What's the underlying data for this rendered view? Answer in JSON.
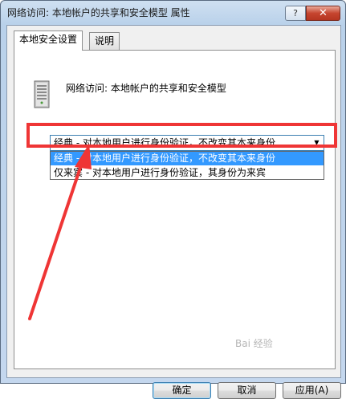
{
  "window": {
    "title": "网络访问: 本地帐户的共享和安全模型 属性",
    "help_label": "?",
    "close_label": "✕"
  },
  "tabs": [
    {
      "label": "本地安全设置"
    },
    {
      "label": "说明"
    }
  ],
  "policy": {
    "icon": "server-icon",
    "name": "网络访问: 本地帐户的共享和安全模型"
  },
  "combo": {
    "selected": "经典 - 对本地用户进行身份验证，不改变其本来身份",
    "arrow": "▼"
  },
  "dropdown": {
    "options": [
      "经典 - 对本地用户进行身份验证，不改变其本来身份",
      "仅来宾 - 对本地用户进行身份验证，其身份为来宾"
    ]
  },
  "buttons": {
    "ok": "确定",
    "cancel": "取消",
    "apply": "应用(A)"
  },
  "watermark": "Bai 经验",
  "colors": {
    "highlight": "#ef3535",
    "selection": "#3399ff"
  }
}
